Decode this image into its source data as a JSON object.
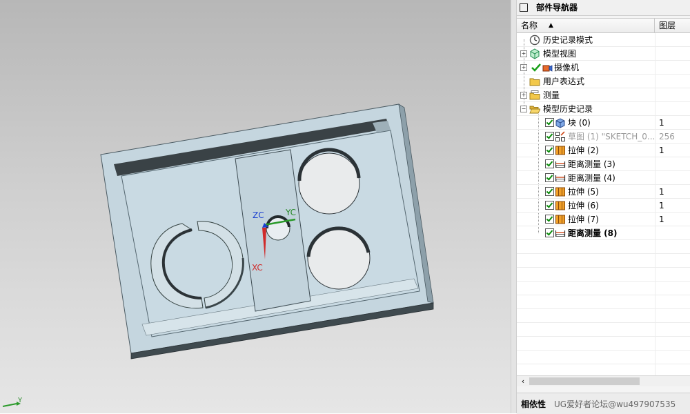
{
  "navigator": {
    "title": "部件导航器",
    "columns": {
      "name": "名称",
      "layer": "图层"
    },
    "rows": [
      {
        "label": "历史记录模式",
        "layer": ""
      },
      {
        "label": "模型视图",
        "layer": ""
      },
      {
        "label": "摄像机",
        "layer": ""
      },
      {
        "label": "用户表达式",
        "layer": ""
      },
      {
        "label": "测量",
        "layer": ""
      },
      {
        "label": "模型历史记录",
        "layer": ""
      },
      {
        "label": "块 (0)",
        "layer": "1"
      },
      {
        "label": "草图 (1) \"SKETCH_0...",
        "layer": "256"
      },
      {
        "label": "拉伸 (2)",
        "layer": "1"
      },
      {
        "label": "距离测量 (3)",
        "layer": ""
      },
      {
        "label": "距离测量 (4)",
        "layer": ""
      },
      {
        "label": "拉伸 (5)",
        "layer": "1"
      },
      {
        "label": "拉伸 (6)",
        "layer": "1"
      },
      {
        "label": "拉伸 (7)",
        "layer": "1"
      },
      {
        "label": "距离测量 (8)",
        "layer": ""
      }
    ],
    "bottom": {
      "dependency_label": "相依性",
      "watermark": "UG爱好者论坛@wu497907535"
    }
  },
  "viewport": {
    "axes": {
      "zc": "ZC",
      "yc": "YC",
      "xc": "XC"
    },
    "wcs_label": "Y"
  }
}
